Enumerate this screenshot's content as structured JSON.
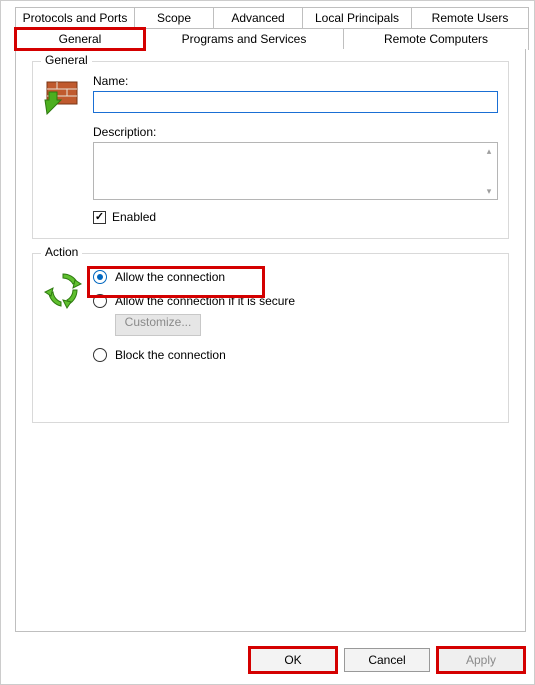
{
  "tabs_row1": {
    "t0": "Protocols and Ports",
    "t1": "Scope",
    "t2": "Advanced",
    "t3": "Local Principals",
    "t4": "Remote Users"
  },
  "tabs_row2": {
    "t0": "General",
    "t1": "Programs and Services",
    "t2": "Remote Computers"
  },
  "general_group": {
    "legend": "General",
    "name_label": "Name:",
    "name_value": "",
    "description_label": "Description:",
    "description_value": "",
    "enabled_label": "Enabled",
    "enabled_checked": true
  },
  "action_group": {
    "legend": "Action",
    "allow_label": "Allow the connection",
    "allow_secure_label": "Allow the connection if it is secure",
    "customize_label": "Customize...",
    "block_label": "Block the connection",
    "selected": "allow"
  },
  "buttons": {
    "ok": "OK",
    "cancel": "Cancel",
    "apply": "Apply"
  }
}
